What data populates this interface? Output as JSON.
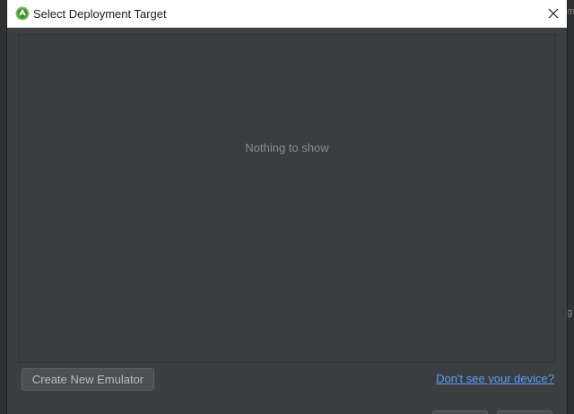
{
  "window": {
    "title": "Select Deployment Target",
    "app_icon": "android-studio-icon",
    "close_icon": "close-icon"
  },
  "device_list": {
    "empty_text": "Nothing to show"
  },
  "footer": {
    "create_emulator_label": "Create New Emulator",
    "device_help_link": "Don't see your device?"
  },
  "background": {
    "mark_top_right": "m",
    "mark_mid_right": "g"
  },
  "colors": {
    "dialog_background": "#3c3f41",
    "panel_background": "#3a3d3f",
    "link": "#589df6",
    "titlebar": "#ffffff"
  }
}
